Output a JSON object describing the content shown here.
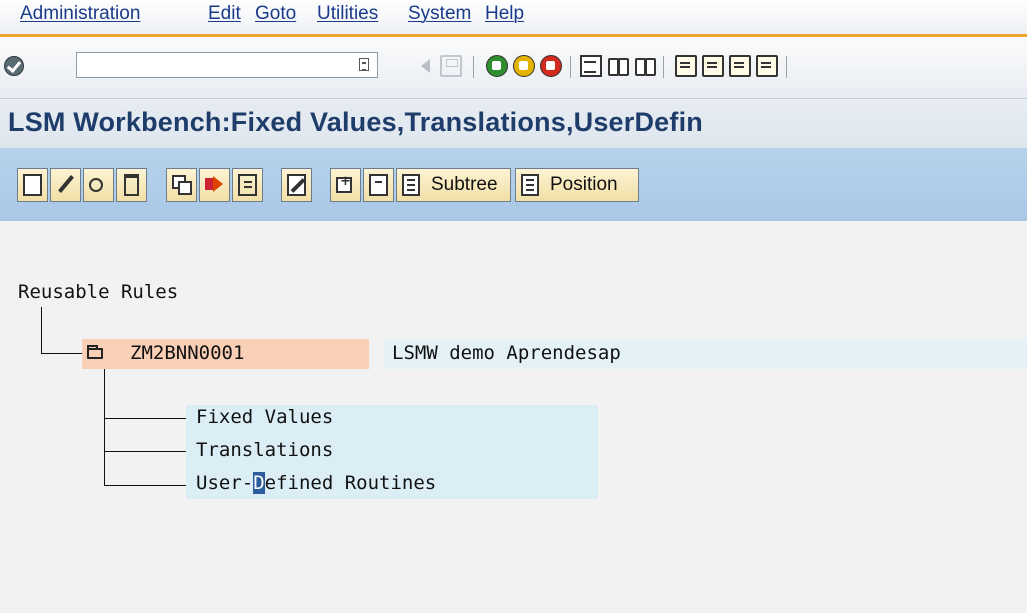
{
  "menu": [
    "Administration",
    "Edit",
    "Goto",
    "Utilities",
    "System",
    "Help"
  ],
  "command_field": {
    "value": ""
  },
  "title": "LSM Workbench:Fixed Values,Translations,UserDefin",
  "app_toolbar": {
    "subtree_label": "Subtree",
    "position_label": "Position"
  },
  "tree": {
    "root": "Reusable Rules",
    "node": {
      "id": "ZM2BNN0001",
      "description": "LSMW demo Aprendesap"
    },
    "children": {
      "fixed_values": "Fixed Values",
      "translations": "Translations",
      "user_defined": {
        "before": "User-",
        "cursor": "D",
        "after": "efined Routines"
      }
    }
  },
  "colors": {
    "menu_text": "#1a3a8a",
    "accent_rule": "#f0a22e",
    "title_text": "#1e3d6b",
    "app_toolbar_bg": "#b7d2ec",
    "button_bg": "#f1dfa6",
    "node_highlight": "#f9cfb6",
    "child_highlight": "#dbeef6"
  },
  "icons": {
    "system_toolbar": [
      "enter-check-icon",
      "command-history-icon",
      "back-arrow-icon",
      "save-icon",
      "back-icon",
      "exit-icon",
      "cancel-icon",
      "print-icon",
      "find-icon",
      "find-next-icon",
      "first-page-icon",
      "previous-page-icon",
      "next-page-icon",
      "last-page-icon"
    ],
    "app_toolbar": [
      "create-icon",
      "change-icon",
      "display-icon",
      "delete-icon",
      "copy-icon",
      "move-icon",
      "expand-icon",
      "edit-icon",
      "expand-subtree-icon",
      "collapse-subtree-icon",
      "subtree-icon",
      "position-icon"
    ]
  }
}
